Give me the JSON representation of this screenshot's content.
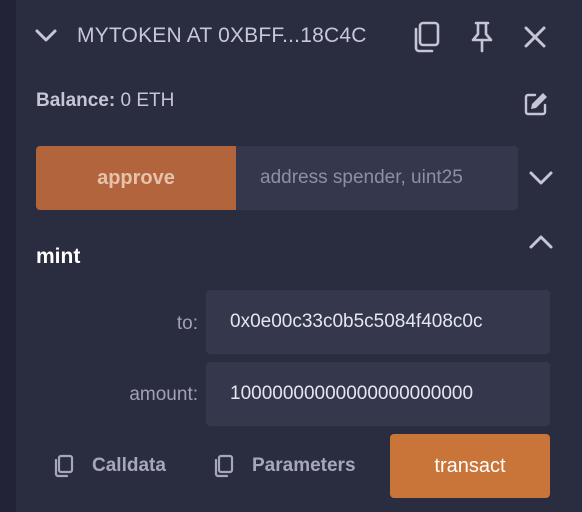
{
  "instance": {
    "title": "MYTOKEN AT 0XBFF...18C4C"
  },
  "balance": {
    "label": "Balance:",
    "value": "0 ETH"
  },
  "approve": {
    "button_label": "approve",
    "placeholder": "address spender, uint25"
  },
  "mint": {
    "title": "mint",
    "fields": [
      {
        "label": "to:",
        "value": "0x0e00c33c0b5c5084f408c0c"
      },
      {
        "label": "amount:",
        "value": "10000000000000000000000"
      }
    ],
    "calldata_label": "Calldata",
    "parameters_label": "Parameters",
    "transact_label": "transact"
  },
  "colors": {
    "background": "#2a2c3f",
    "approve_button": "#b2643d",
    "transact_button": "#c97539",
    "input_background": "#35374c"
  }
}
